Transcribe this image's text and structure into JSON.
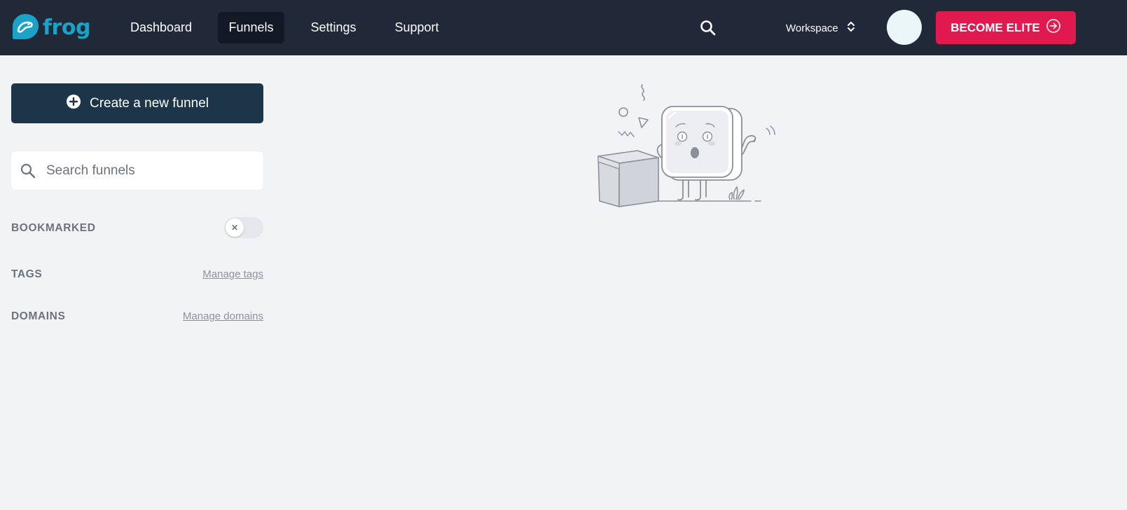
{
  "brand": {
    "name": "frog",
    "color": "#1ba2c8",
    "icon": "frog-logo-icon"
  },
  "nav": {
    "items": [
      {
        "label": "Dashboard",
        "active": false
      },
      {
        "label": "Funnels",
        "active": true
      },
      {
        "label": "Settings",
        "active": false
      },
      {
        "label": "Support",
        "active": false
      }
    ]
  },
  "header": {
    "search_icon": "search-icon",
    "workspace_label": "Workspace",
    "workspace_icon": "chevron-updown-icon",
    "elite_label": "BECOME ELITE",
    "elite_icon": "arrow-circle-right-icon"
  },
  "sidebar": {
    "create_label": "Create a new funnel",
    "create_icon": "plus-circle-icon",
    "search_placeholder": "Search funnels",
    "search_value": "",
    "bookmarked_label": "BOOKMARKED",
    "bookmarked_enabled": false,
    "tags_label": "TAGS",
    "tags_link": "Manage tags",
    "domains_label": "DOMAINS",
    "domains_link": "Manage domains"
  },
  "empty_state": {
    "illustration": "empty-box-character-illustration"
  },
  "colors": {
    "topbar": "#212837",
    "active_nav": "#131826",
    "elite_button": "#e01a4f",
    "create_button": "#1c3549",
    "background": "#f2f3f5"
  }
}
